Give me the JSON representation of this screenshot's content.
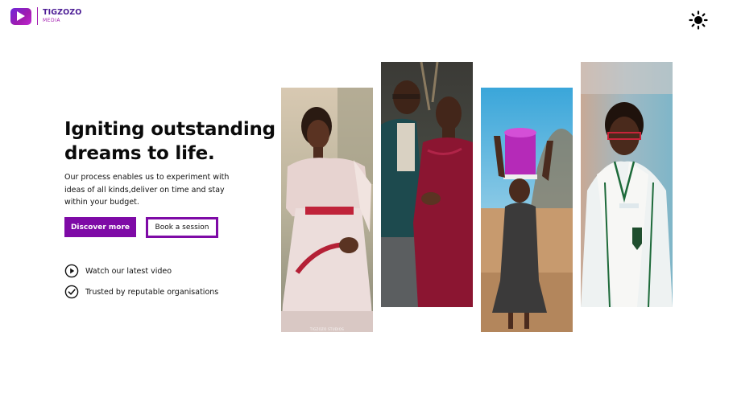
{
  "brand": {
    "name_line1": "TIGZOZO",
    "name_line2": "MEDIA",
    "colors": {
      "primary": "#7e0aa6",
      "logo_gradient_start": "#6d28d9",
      "logo_gradient_end": "#c026d3"
    }
  },
  "header": {
    "theme_toggle_icon": "sun-icon"
  },
  "hero": {
    "headline": "Igniting outstanding dreams to life.",
    "description": "Our process enables us to experiment with ideas of all kinds,deliver on time and stay within your budget.",
    "primary_button": "Discover more",
    "secondary_button": "Book a session",
    "features": [
      {
        "icon": "play-circle-icon",
        "label": "Watch our latest video"
      },
      {
        "icon": "check-circle-icon",
        "label": "Trusted by reputable organisations"
      }
    ]
  },
  "gallery": {
    "photos": [
      {
        "subject": "woman-in-dress-photo",
        "watermark": "TIGZOZO STUDIOS"
      },
      {
        "subject": "couple-photo",
        "watermark": ""
      },
      {
        "subject": "girl-carrying-bucket-photo",
        "watermark": ""
      },
      {
        "subject": "student-in-uniform-photo",
        "watermark": ""
      }
    ]
  }
}
